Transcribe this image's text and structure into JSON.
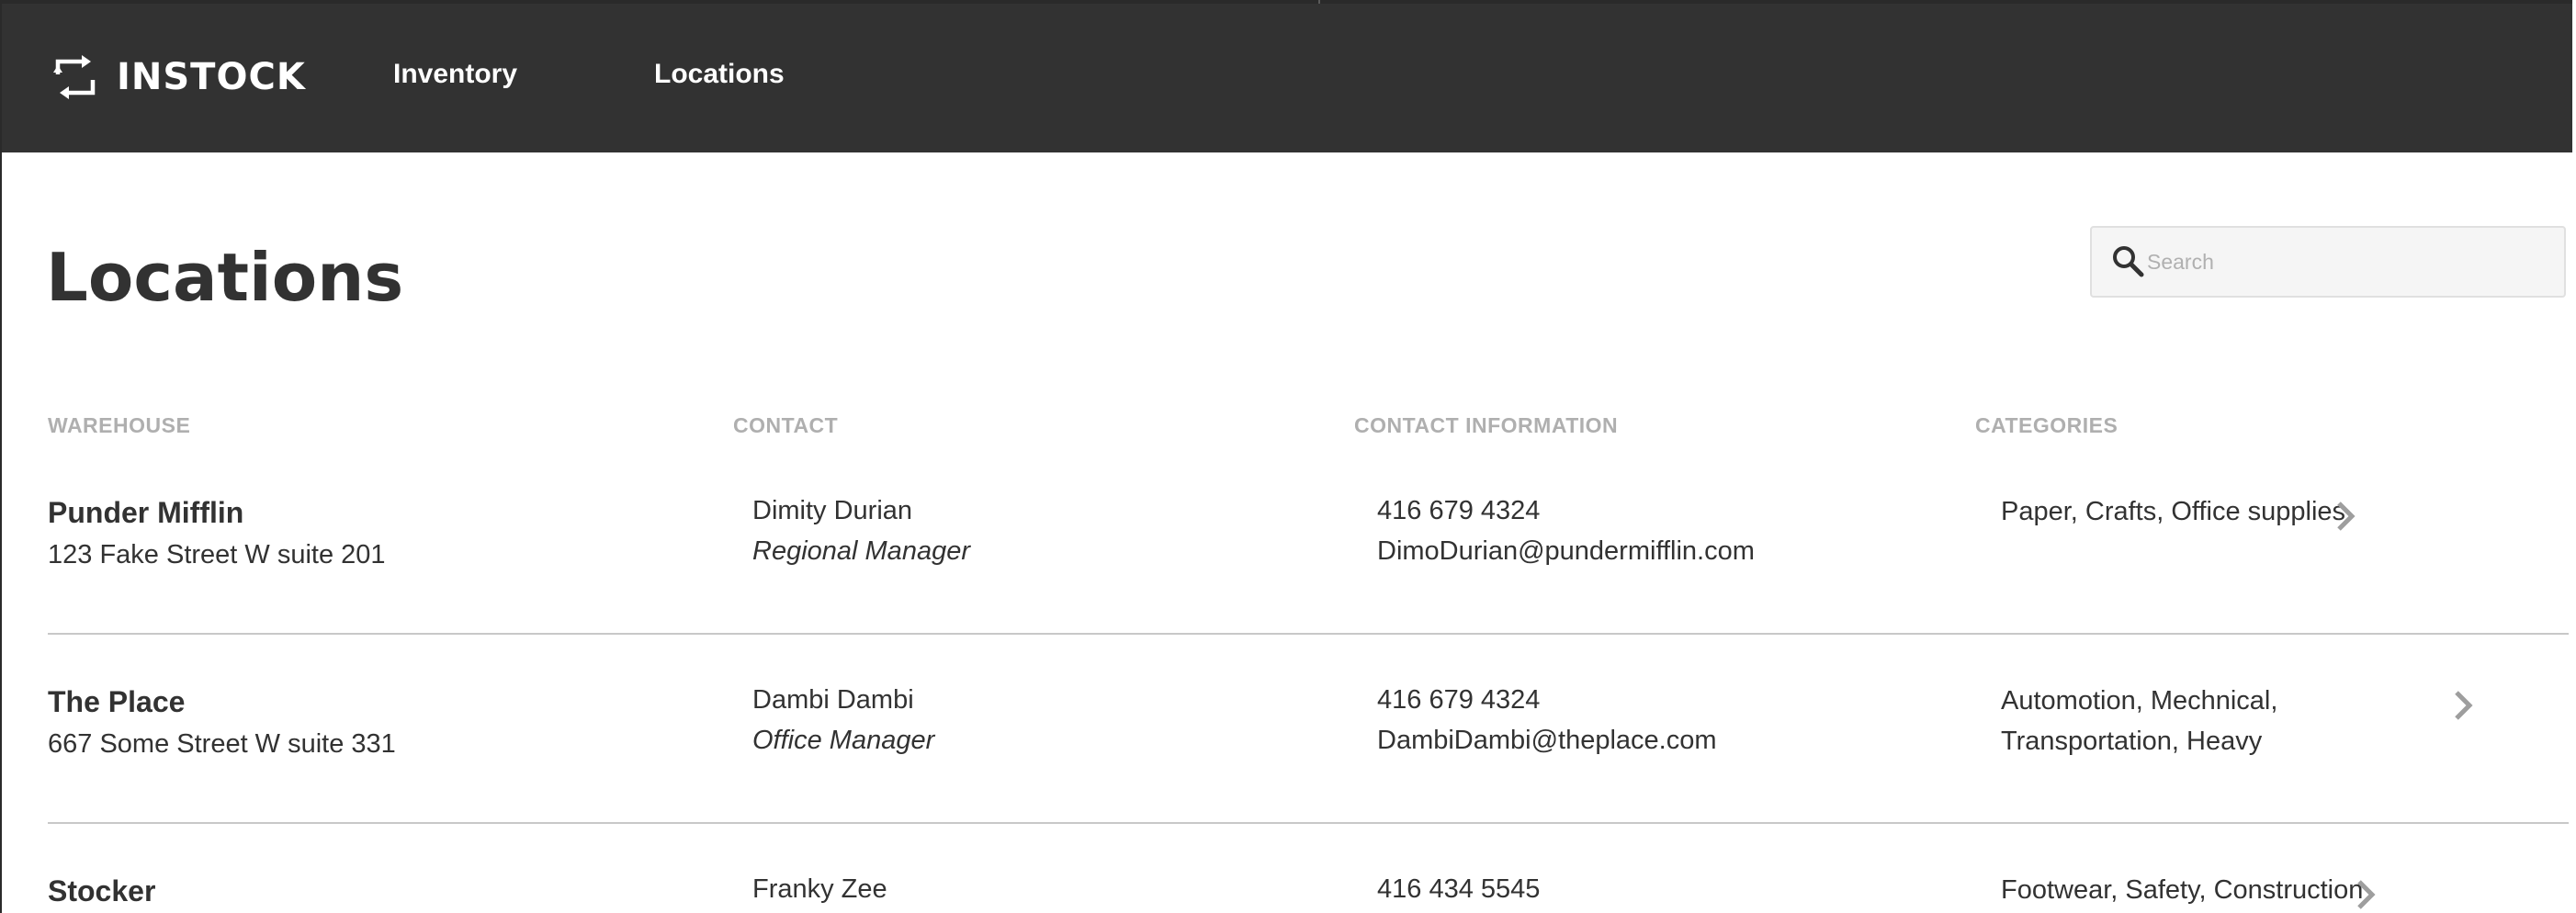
{
  "app": {
    "brand": "INSTOCK",
    "logo_icon": "sync-arrows-icon"
  },
  "nav": {
    "items": [
      {
        "label": "Inventory"
      },
      {
        "label": "Locations"
      }
    ]
  },
  "page": {
    "title": "Locations"
  },
  "search": {
    "placeholder": "Search",
    "value": "",
    "icon": "search-icon"
  },
  "table": {
    "headers": [
      "WAREHOUSE",
      "CONTACT",
      "CONTACT INFORMATION",
      "CATEGORIES"
    ],
    "rows": [
      {
        "warehouse": "Punder Mifflin",
        "address": "123 Fake Street W suite 201",
        "contact_name": "Dimity Durian",
        "contact_title": "Regional Manager",
        "phone": "416 679 4324",
        "email": "DimoDurian@pundermifflin.com",
        "categories": "Paper, Crafts, Office supplies"
      },
      {
        "warehouse": "The Place",
        "address": "667 Some Street W suite 331",
        "contact_name": "Dambi Dambi",
        "contact_title": "Office Manager",
        "phone": "416 679 4324",
        "email": "DambiDambi@theplace.com",
        "categories": "Automotion, Mechnical, Transportation, Heavy"
      },
      {
        "warehouse": "Stocker",
        "address": "",
        "contact_name": "Franky Zee",
        "contact_title": "",
        "phone": "416 434 5545",
        "email": "",
        "categories": "Footwear, Safety, Construction"
      }
    ]
  },
  "colors": {
    "header_bg": "#323232",
    "text": "#323232",
    "muted": "#afafaf",
    "divider": "#c8c8c8",
    "search_bg": "#f5f5f5"
  }
}
